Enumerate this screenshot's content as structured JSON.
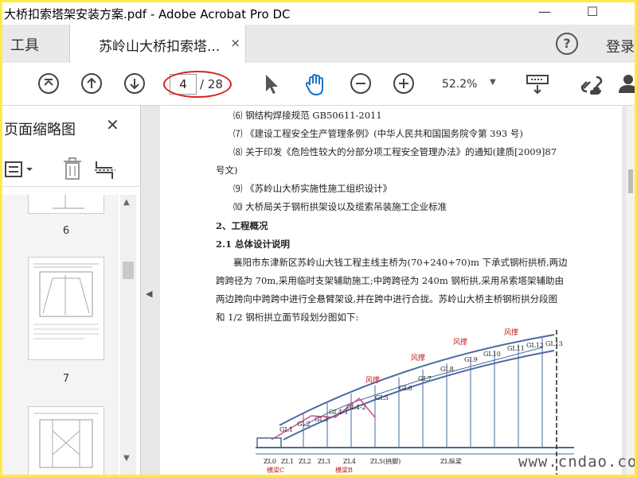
{
  "window": {
    "title": "大桥扣索塔架安装方案.pdf - Adobe Acrobat Pro DC",
    "minimize": "—",
    "maximize": "☐"
  },
  "tabs": {
    "tools": "工具",
    "document": "苏岭山大桥扣索塔...",
    "close": "×",
    "help": "?",
    "login": "登录"
  },
  "toolbar": {
    "current_page": "4",
    "total_pages": "/ 28",
    "zoom": "52.2%",
    "icons": [
      "first-page-icon",
      "prev-page-icon",
      "next-page-icon",
      "select-cursor-icon",
      "hand-tool-icon",
      "zoom-out-icon",
      "zoom-in-icon",
      "read-mode-icon",
      "link-icon",
      "user-icon"
    ],
    "annotation_color": "#d82020"
  },
  "sidebar": {
    "title": "页面缩略图",
    "close": "✕",
    "thumbnails": [
      {
        "label": "6"
      },
      {
        "label": "7"
      },
      {
        "label": ""
      }
    ]
  },
  "document": {
    "lines": [
      "⑹ 钢结构焊接规范 GB50611-2011",
      "⑺ 《建设工程安全生产管理条例》(中华人民共和国国务院令第 393 号)",
      "⑻ 关于印发《危险性较大的分部分项工程安全管理办法》的通知(建质[2009]87",
      "号文)",
      "⑼ 《苏岭山大桥实施性施工组织设计》",
      "⑽ 大桥局关于钢桁拱架设以及缆索吊装施工企业标准",
      "2、工程概况",
      "2.1 总体设计说明",
      "襄阳市东津新区苏岭山大钱工程主线主桥为(70+240+70)m 下承式钢桁拱桥,两边",
      "跨跨径为 70m,采用临时支架辅助施工;中跨跨径为 240m 钢桁拱,采用吊索塔架辅助由",
      "两边跨向中跨跨中进行全悬臂架设,并在跨中进行合拢。苏岭山大桥主桥钢桁拱分段图",
      "和 1/2 钢桁拱立面节段划分图如下:"
    ],
    "diagram_labels": {
      "wind_braces": [
        "风撑",
        "风撑",
        "风撑",
        "风撑"
      ],
      "arch_segments": [
        "GL1",
        "GL2",
        "GL3",
        "GL4-1",
        "GL4-2",
        "GL5",
        "GL6",
        "GL7",
        "GL8",
        "GL9",
        "GL10",
        "GL11",
        "GL12",
        "GL13"
      ],
      "bottom_labels": [
        "ZL0",
        "ZL1",
        "ZL2",
        "ZL3",
        "ZL4",
        "ZL5(拱脚)",
        "ZL纵梁"
      ],
      "cross_beams": [
        "横梁C",
        "横梁B"
      ]
    }
  },
  "watermark": "www.cndao.com"
}
